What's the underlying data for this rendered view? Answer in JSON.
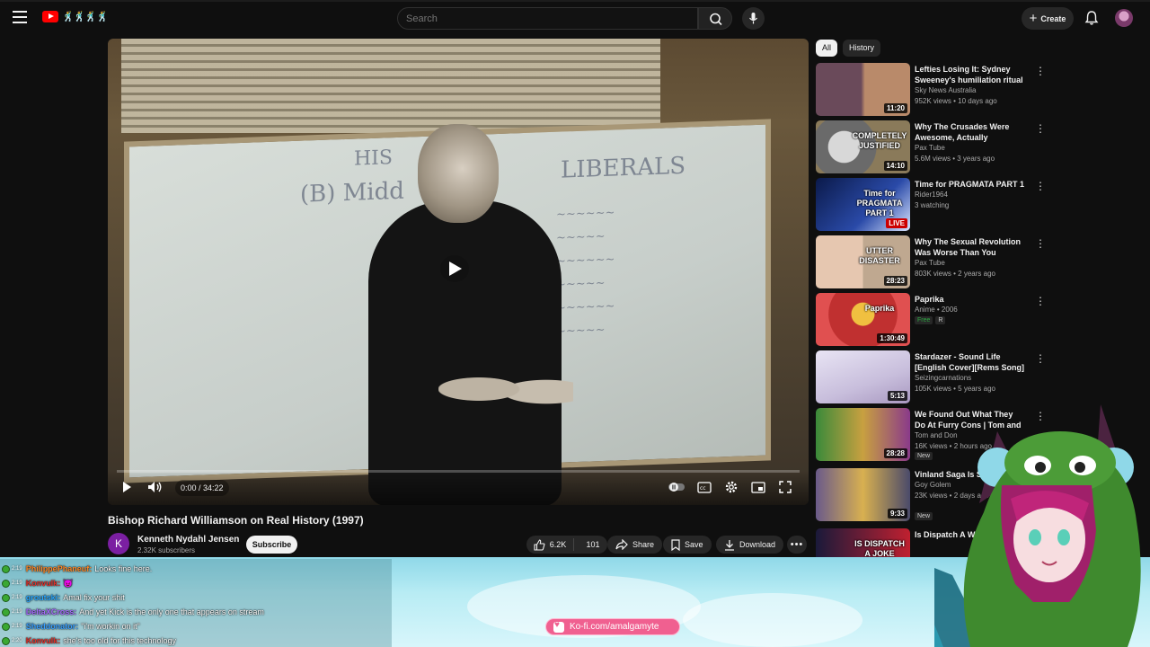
{
  "search": {
    "placeholder": "Search"
  },
  "header": {
    "create_label": "Create"
  },
  "player": {
    "time": "0:00 / 34:22",
    "board_heading": "LIBERALS",
    "board_left_1": "HIS",
    "board_left_2": "(B) Midd"
  },
  "video": {
    "title": "Bishop Richard Williamson on Real History (1997)",
    "channel_initial": "K",
    "channel_name": "Kenneth Nydahl Jensen",
    "subscribers": "2.32K subscribers",
    "subscribe_label": "Subscribe",
    "likes": "6.2K",
    "dislikes": "101",
    "share_label": "Share",
    "save_label": "Save",
    "download_label": "Download"
  },
  "sidebar": {
    "chips": [
      "All",
      "History"
    ],
    "recs": [
      {
        "title": "Lefties Losing It: Sydney Sweeney's humiliation ritual ...",
        "channel": "Sky News Australia",
        "meta": "952K views • 10 days ago",
        "duration": "11:20"
      },
      {
        "title": "Why The Crusades Were Awesome, Actually",
        "channel": "Pax Tube",
        "meta": "5.6M views • 3 years ago",
        "duration": "14:10",
        "thumb_text": "COMPLETELY JUSTIFIED"
      },
      {
        "title": "Time for PRAGMATA  PART 1",
        "channel": "Rider1964",
        "meta": "3 watching",
        "duration": "LIVE",
        "thumb_text": "Time for PRAGMATA PART 1"
      },
      {
        "title": "Why The Sexual Revolution Was Worse Than You Thought",
        "channel": "Pax Tube",
        "meta": "803K views • 2 years ago",
        "duration": "28:23",
        "thumb_text": "UTTER DISASTER"
      },
      {
        "title": "Paprika",
        "channel": "Anime • 2006",
        "meta": "",
        "duration": "1:30:49",
        "badge_free": "Free",
        "badge_rating": "R",
        "thumb_text": "Paprika"
      },
      {
        "title": "Stardazer - Sound Life [English Cover][Rems Song]",
        "channel": "Seizingcarnations",
        "meta": "105K views • 5 years ago",
        "duration": "5:13"
      },
      {
        "title": "We Found Out What They Do At Furry Cons | Tom and Don",
        "channel": "Tom and Don",
        "meta": "16K views • 2 hours ago",
        "duration": "28:28",
        "badge": "New"
      },
      {
        "title": "Vinland Saga Is So Goyslop",
        "channel": "Goy Golem",
        "meta": "23K views • 2 days ago",
        "duration": "9:33",
        "badge": "New"
      },
      {
        "title": "Is Dispatch A What Every",
        "channel": "",
        "meta": "",
        "duration": "",
        "thumb_text": "IS DISPATCH A JOKE"
      }
    ]
  },
  "chat": [
    {
      "time": "2:19",
      "user": "PhilippePhaneuf:",
      "msg": "Looks fine here.",
      "color": "#ff8a2a"
    },
    {
      "time": "2:19",
      "user": "Konvulk:",
      "msg": "😈",
      "color": "#e0302a"
    },
    {
      "time": "2:19",
      "user": "groutski:",
      "msg": "Amal fix your shit",
      "color": "#2aa8ff"
    },
    {
      "time": "2:19",
      "user": "DeltaXCross:",
      "msg": "And yet Kick is the only one that appears on stream",
      "color": "#a86cff"
    },
    {
      "time": "2:19",
      "user": "Sheddonator:",
      "msg": "\"i'm workin on it\"",
      "color": "#3aa0ff"
    },
    {
      "time": "2:20",
      "user": "Konvulk:",
      "msg": "she's too old for this technology",
      "color": "#e0302a"
    }
  ],
  "kofi": {
    "label": "Ko-fi.com/amalgamyte"
  },
  "colors": {
    "accent": "#ff0000",
    "bg": "#0f0f0f",
    "kofi": "#f06090"
  }
}
